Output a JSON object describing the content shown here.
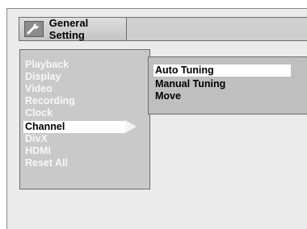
{
  "header": {
    "title": "General Setting",
    "icon": "wrench-icon"
  },
  "menu": {
    "items": [
      {
        "label": "Playback"
      },
      {
        "label": "Display"
      },
      {
        "label": "Video"
      },
      {
        "label": "Recording"
      },
      {
        "label": "Clock"
      },
      {
        "label": "Channel"
      },
      {
        "label": "DivX"
      },
      {
        "label": "HDMI"
      },
      {
        "label": "Reset All"
      }
    ],
    "selected": "Channel"
  },
  "submenu": {
    "items": [
      {
        "label": "Auto Tuning"
      },
      {
        "label": "Manual Tuning"
      },
      {
        "label": "Move"
      }
    ],
    "selected": "Auto Tuning"
  }
}
